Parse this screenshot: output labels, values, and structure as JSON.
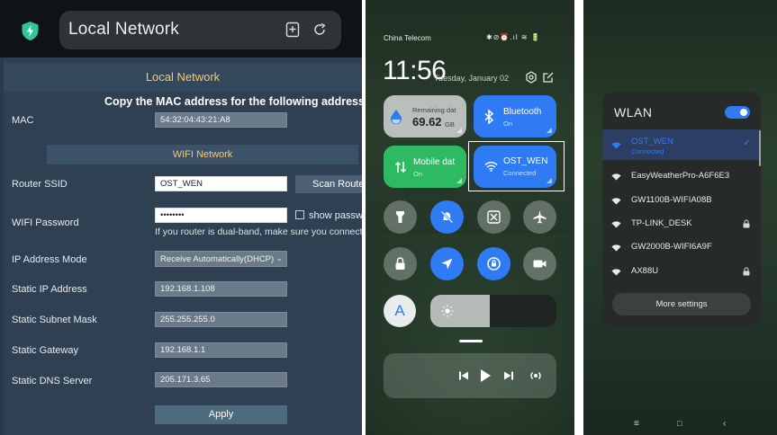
{
  "panel1": {
    "browser_title": "Local Network",
    "page_header": "Local Network",
    "copy_instruction": "Copy the MAC address for the following address",
    "mac_label": "MAC",
    "mac_value": "54:32:04:43:21:A8",
    "wifi_section": "WIFI Network",
    "ssid_label": "Router SSID",
    "ssid_value": "OST_WEN",
    "scan_button": "Scan Router",
    "password_label": "WIFI Password",
    "password_value": "••••••••",
    "show_password_label": "show password",
    "dual_band_hint": "If you router is dual-band, make sure you connect to",
    "ip_mode_label": "IP Address Mode",
    "ip_mode_value": "Receive Automatically(DHCP)",
    "static_ip_label": "Static IP Address",
    "static_ip_value": "192.168.1.108",
    "subnet_label": "Static Subnet Mask",
    "subnet_value": "255.255.255.0",
    "gateway_label": "Static Gateway",
    "gateway_value": "192.168.1.1",
    "dns_label": "Static DNS Server",
    "dns_value": "205.171.3.65",
    "apply_button": "Apply"
  },
  "panel2": {
    "carrier": "China Telecom",
    "status_icons": "✱⊘⏰.ıl ≋ 🔋",
    "time": "11:56",
    "date": "Tuesday, January 02",
    "data_tile": {
      "label": "Remaining dat",
      "value": "69.62",
      "unit": "GB"
    },
    "bluetooth_tile": {
      "title": "Bluetooth",
      "status": "On"
    },
    "mobile_tile": {
      "title": "Mobile dat",
      "status": "On"
    },
    "wifi_tile": {
      "title": "OST_WEN",
      "status": "Connected"
    },
    "auto_brightness_label": "A",
    "brightness_level": 0.47
  },
  "panel3": {
    "title": "WLAN",
    "toggle_on": true,
    "connected_network": {
      "name": "OST_WEN",
      "status": "Connected"
    },
    "networks": [
      {
        "name": "EasyWeatherPro-A6F6E3",
        "locked": false
      },
      {
        "name": "GW1100B-WIFIA08B",
        "locked": false
      },
      {
        "name": "TP-LINK_DESK",
        "locked": true
      },
      {
        "name": "GW2000B-WIFI6A9F",
        "locked": false
      },
      {
        "name": "AX88U",
        "locked": true
      }
    ],
    "more_settings": "More settings"
  },
  "colors": {
    "accent_blue": "#2f7bf3",
    "tile_green": "#2dba62",
    "header_gold": "#f2c879"
  }
}
